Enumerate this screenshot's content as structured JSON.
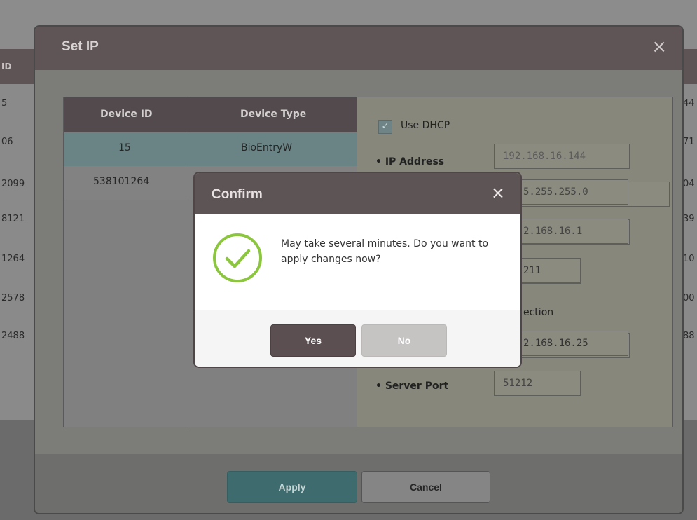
{
  "background": {
    "left_cells": [
      "ID",
      "5",
      "06",
      "2099",
      "8121",
      "1264",
      "2578",
      "2488"
    ],
    "right_cells": [
      "44",
      "71",
      "04",
      "39",
      "10",
      "00",
      "88"
    ]
  },
  "set_ip": {
    "title": "Set IP",
    "close_icon": "×",
    "table": {
      "columns": [
        "Device ID",
        "Device Type"
      ],
      "rows": [
        {
          "device_id": "15",
          "device_type": "BioEntryW"
        },
        {
          "device_id": "538101264",
          "device_type": ""
        }
      ]
    },
    "settings": {
      "use_dhcp_label": "Use DHCP",
      "use_dhcp_checked": true,
      "ip_address_label": "• IP Address",
      "ip_address_value": "192.168.16.144",
      "subnet_value_visible": "5.255.255.0",
      "gateway_value_visible": "2.168.16.1",
      "port_value_visible": "211",
      "connection_label_visible": "ection",
      "server_ip_value_visible": "2.168.16.25",
      "server_port_label": "• Server Port",
      "server_port_value": "51212"
    },
    "buttons": {
      "apply": "Apply",
      "cancel": "Cancel"
    }
  },
  "confirm": {
    "title": "Confirm",
    "close_icon": "×",
    "icon": "check-circle-icon",
    "message": "May take several minutes. Do you want to apply changes now?",
    "buttons": {
      "yes": "Yes",
      "no": "No"
    }
  },
  "colors": {
    "confirm_header": "#5d5456",
    "check_green": "#8cc63f",
    "yes_button": "#5c4f52",
    "no_button": "#c6c3c3",
    "apply_button": "#3e6b6e"
  }
}
